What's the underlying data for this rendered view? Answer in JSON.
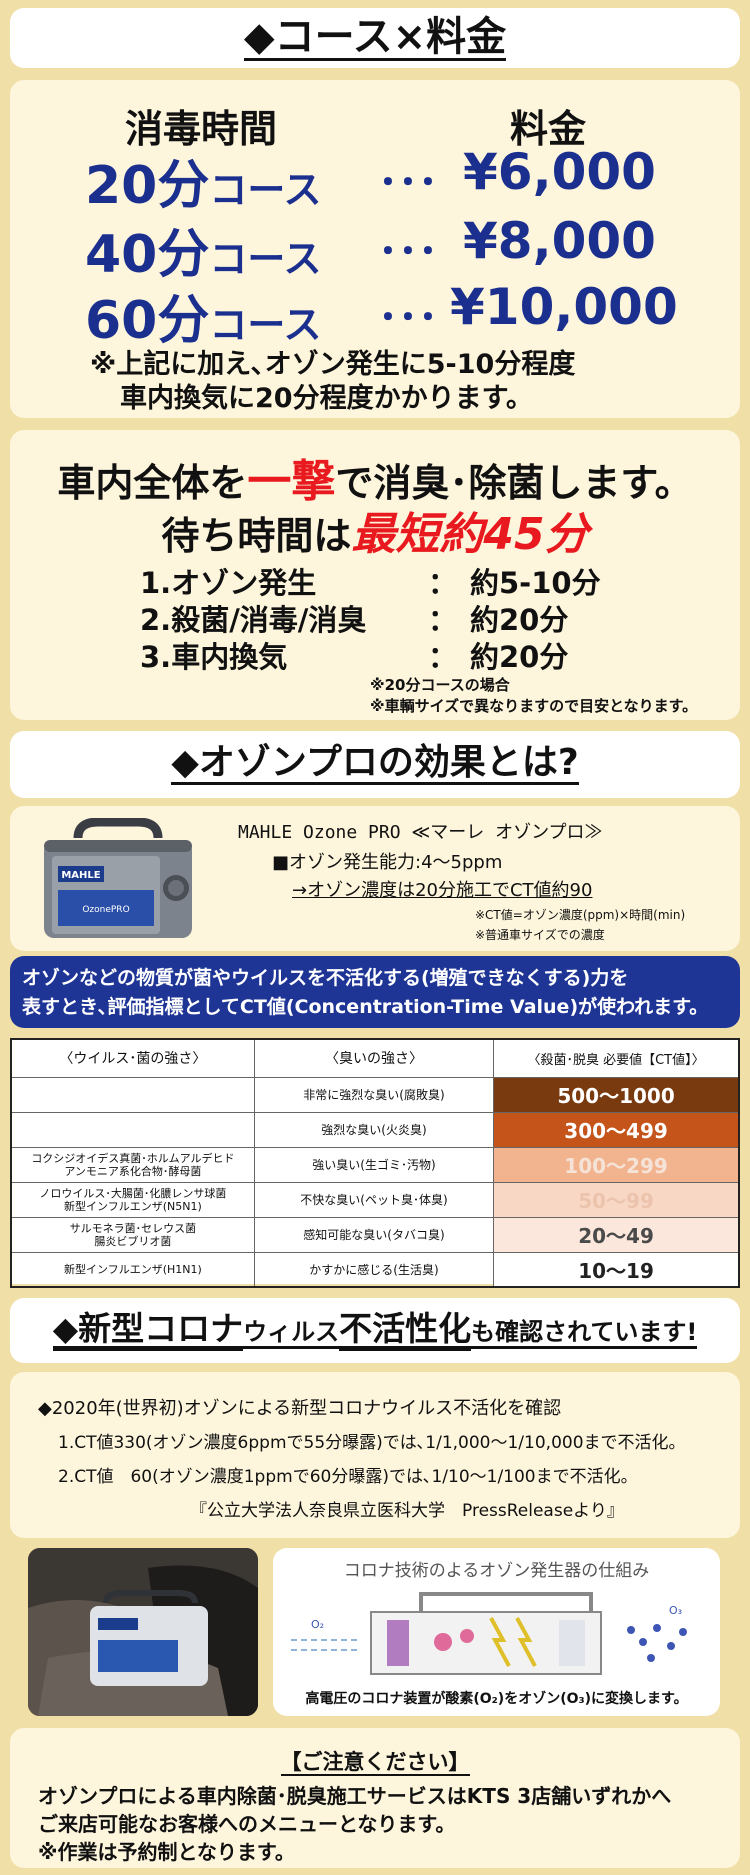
{
  "s1": {
    "title": "◆コース×料金",
    "col_time": "消毒時間",
    "col_price": "料金",
    "courses": [
      {
        "min": "20分",
        "label": "コース",
        "dots": "･･･",
        "price": "¥6,000"
      },
      {
        "min": "40分",
        "label": "コース",
        "dots": "･･･",
        "price": "¥8,000"
      },
      {
        "min": "60分",
        "label": "コース",
        "dots": "･･･",
        "price": "¥10,000"
      }
    ],
    "note1": "※上記に加え､オゾン発生に5-10分程度",
    "note2": "車内換気に20分程度かかります。"
  },
  "s2": {
    "line1_a": "車内全体を",
    "line1_b": "一撃",
    "line1_c": "で消臭･除菌します。",
    "line2_a": "待ち時間は",
    "line2_b": "最短約45分",
    "steps": [
      {
        "label": "1.オゾン発生",
        "sep": "：",
        "value": "約5-10分"
      },
      {
        "label": "2.殺菌/消毒/消臭",
        "sep": "：",
        "value": "約20分"
      },
      {
        "label": "3.車内換気",
        "sep": "：",
        "value": "約20分"
      }
    ],
    "foot1": "※20分コースの場合",
    "foot2": "※車輌サイズで異なりますので目安となります。"
  },
  "s3": {
    "title": "◆オゾンプロの効果とは?",
    "product_name": "MAHLE Ozone PRO ≪マーレ オゾンプロ≫",
    "capacity": "■オゾン発生能力:4～5ppm",
    "ct_value": "→オゾン濃度は20分施工でCT値約90",
    "note_ct": "※CT値=オゾン濃度(ppm)×時間(min)",
    "note_car": "※普通車サイズでの濃度",
    "device_brand": "MAHLE",
    "device_model": "OzonePRO"
  },
  "banner": {
    "line1": "オゾンなどの物質が菌やウイルスを不活化する(増殖できなくする)力を",
    "line2": "表すとき､評価指標としてCT値(Concentration-Time Value)が使われます。"
  },
  "table": {
    "headers": [
      "〈ウイルス･菌の強さ〉",
      "〈臭いの強さ〉",
      "〈殺菌･脱臭 必要値【CT値】〉"
    ],
    "rows": [
      {
        "virus": "",
        "smell": "非常に強烈な臭い(腐敗臭)",
        "ct": "500～1000",
        "bg": "#7a3a10",
        "fg": "#ffffff"
      },
      {
        "virus": "",
        "smell": "強烈な臭い(火炎臭)",
        "ct": "300～499",
        "bg": "#c5541b",
        "fg": "#ffffff"
      },
      {
        "virus": "コクシジオイデス真菌･ホルムアルデヒド\nアンモニア系化合物･酵母菌",
        "smell": "強い臭い(生ゴミ･汚物)",
        "ct": "100～299",
        "bg": "#f1b48f",
        "fg": "#f6e3d8"
      },
      {
        "virus": "ノロウイルス･大腸菌･化膿レンサ球菌\n新型インフルエンザ(N5N1)",
        "smell": "不快な臭い(ペット臭･体臭)",
        "ct": "50～99",
        "bg": "#f8d8c5",
        "fg": "#ecc3ac"
      },
      {
        "virus": "サルモネラ菌･セレウス菌\n腸炎ビブリオ菌",
        "smell": "感知可能な臭い(タバコ臭)",
        "ct": "20～49",
        "bg": "#fbe7dc",
        "fg": "#4a4a4a"
      },
      {
        "virus": "新型インフルエンザ(H1N1)",
        "smell": "かすかに感じる(生活臭)",
        "ct": "10～19",
        "bg": "#ffffff",
        "fg": "#222222"
      }
    ]
  },
  "s4": {
    "title_a": "◆新型コロナ",
    "title_b": "ウィルス",
    "title_c": "不活性化",
    "title_d": "も確認されています!",
    "point": "◆2020年(世界初)オゾンによる新型コロナウイルス不活化を確認",
    "item1": "1.CT値330(オゾン濃度6ppmで55分曝露)では､1/1,000～1/10,000まで不活化。",
    "item2": "2.CT値　60(オゾン濃度1ppmで60分曝露)では､1/10～1/100まで不活化。",
    "source": "『公立大学法人奈良県立医科大学　PressReleaseより』"
  },
  "diagram": {
    "title": "コロナ技術のよるオゾン発生器の仕組み",
    "caption": "高電圧のコロナ装置が酸素(O₂)をオゾン(O₃)に変換します。",
    "o2": "O₂",
    "o3": "O₃"
  },
  "notice": {
    "title": "【ご注意ください】",
    "line1": "オゾンプロによる車内除菌･脱臭施工サービスはKTS 3店舗いずれかへ",
    "line2": "ご来店可能なお客様へのメニューとなります。",
    "line3": "※作業は予約制となります。"
  },
  "colors": {
    "navy": "#1b2f8f",
    "red": "#e8191f",
    "banner": "#1f3596",
    "background": "#f0dfa6"
  }
}
